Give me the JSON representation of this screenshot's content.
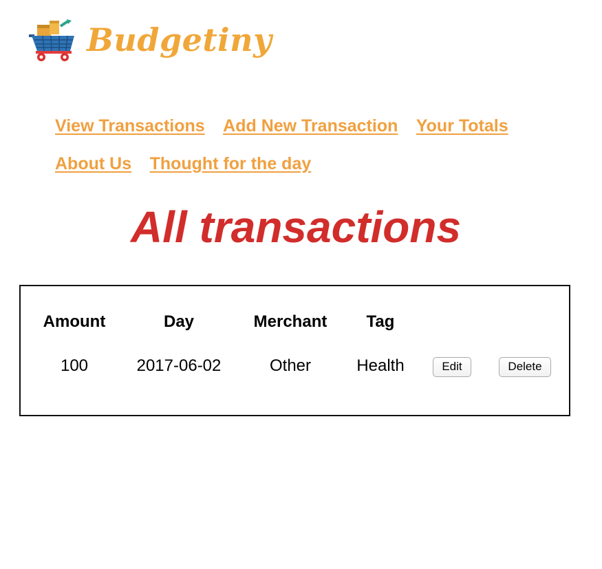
{
  "brand": {
    "name": "Budgetiny",
    "logo_icon": "shopping-cart-icon"
  },
  "nav": {
    "links": [
      {
        "label": "View Transactions"
      },
      {
        "label": "Add New Transaction"
      },
      {
        "label": "Your Totals"
      },
      {
        "label": "About Us"
      },
      {
        "label": "Thought for the day"
      }
    ]
  },
  "page": {
    "title": "All transactions"
  },
  "table": {
    "columns": [
      "Amount",
      "Day",
      "Merchant",
      "Tag"
    ],
    "rows": [
      {
        "amount": "100",
        "day": "2017-06-02",
        "merchant": "Other",
        "tag": "Health",
        "edit_label": "Edit",
        "delete_label": "Delete"
      }
    ]
  },
  "colors": {
    "brand": "#f0a73a",
    "nav_link": "#f0a040",
    "title": "#d12d2b"
  }
}
